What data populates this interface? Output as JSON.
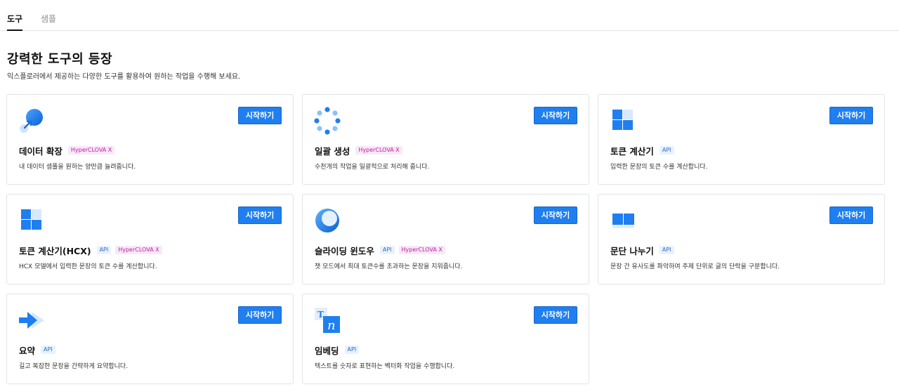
{
  "tabs": [
    {
      "label": "도구",
      "active": true
    },
    {
      "label": "샘플",
      "active": false
    }
  ],
  "page": {
    "title": "강력한 도구의 등장",
    "subtitle": "익스플로러에서 제공하는 다양한 도구를 활용하여 원하는 작업을 수행해 보세요."
  },
  "badges": {
    "api": "API",
    "hcx": "HyperCLOVA X"
  },
  "colors": {
    "accent": "#1f7ff0",
    "api_badge": "#2a6cc7",
    "hcx_badge": "#c21ba6"
  },
  "cards": [
    {
      "title": "데이터 확장",
      "button": "시작하기",
      "description": "내 데이터 샘플을 원하는 양만큼 늘려줍니다.",
      "icon": "data-expand-icon"
    },
    {
      "title": "일괄 생성",
      "button": "시작하기",
      "description": "수천개의 작업을 일괄적으로 처리해 줍니다.",
      "icon": "batch-generate-icon"
    },
    {
      "title": "토큰 계산기",
      "button": "시작하기",
      "description": "입력한 문장의 토큰 수를 계산합니다.",
      "icon": "token-calculator-icon"
    },
    {
      "title": "토큰 계산기(HCX)",
      "button": "시작하기",
      "description": "HCX 모델에서 입력한 문장의 토큰 수를 계산합니다.",
      "icon": "token-calculator-hcx-icon"
    },
    {
      "title": "슬라이딩 윈도우",
      "button": "시작하기",
      "description": "챗 모드에서 최대 토큰수를 초과하는 문장을 지워줍니다.",
      "icon": "sliding-window-icon"
    },
    {
      "title": "문단 나누기",
      "button": "시작하기",
      "description": "문장 간 유사도를 파악하여 주제 단위로 글의 단락을 구분합니다.",
      "icon": "paragraph-split-icon"
    },
    {
      "title": "요약",
      "button": "시작하기",
      "description": "길고 복잡한 문장을 간략하게 요약합니다.",
      "icon": "summary-icon"
    },
    {
      "title": "임베딩",
      "button": "시작하기",
      "description": "텍스트를 숫자로 표현하는 벡터화 작업을 수행합니다.",
      "icon": "embedding-icon"
    }
  ]
}
